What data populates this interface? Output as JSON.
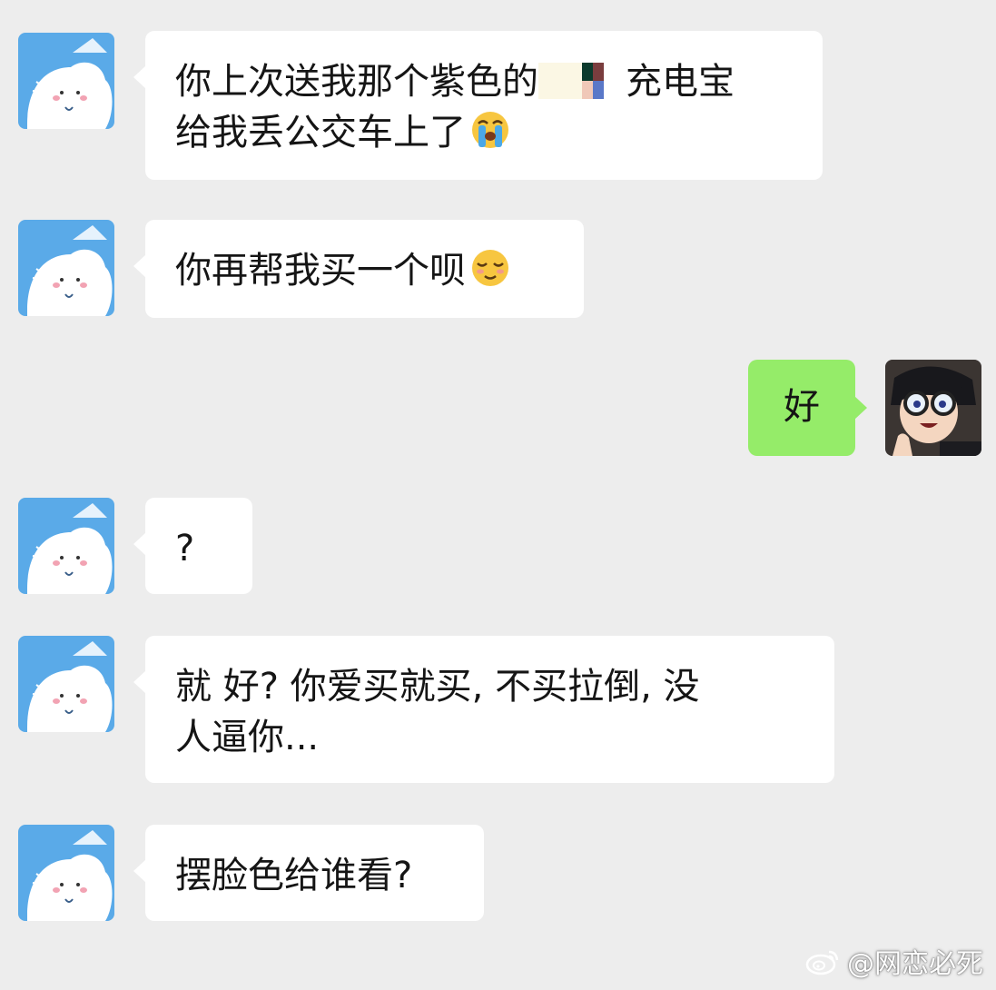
{
  "chat": {
    "messages": [
      {
        "sender": "other",
        "text_before": "你上次送我那个紫色的",
        "text_after": "充电宝",
        "line2": "给我丢公交车上了",
        "emoji": "loudly-crying-face"
      },
      {
        "sender": "other",
        "text": "你再帮我买一个呗",
        "emoji": "smirking-face"
      },
      {
        "sender": "me",
        "text": "好"
      },
      {
        "sender": "other",
        "text": "?"
      },
      {
        "sender": "other",
        "text": "就 好? 你爱买就买, 不买拉倒, 没",
        "line2": "人逼你..."
      },
      {
        "sender": "other",
        "text": "摆脸色给谁看?"
      }
    ]
  },
  "watermark": {
    "text": "@网恋必死",
    "icon": "weibo-icon"
  },
  "colors": {
    "background": "#ededed",
    "bubble_other": "#ffffff",
    "bubble_me": "#95ec69",
    "avatar_other_bg": "#58a9e8"
  }
}
